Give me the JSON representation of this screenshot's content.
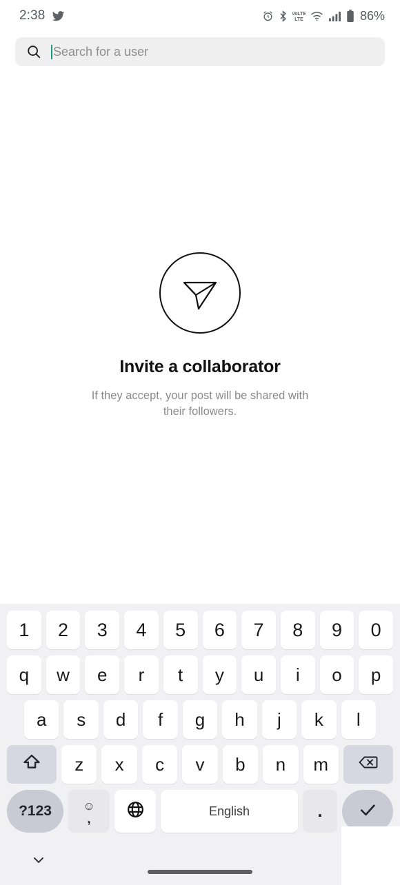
{
  "statusbar": {
    "time": "2:38",
    "app_icon": "twitter-icon",
    "icons": [
      "alarm-icon",
      "bluetooth-icon",
      "volte-icon",
      "wifi-icon",
      "cellular-signal-icon",
      "battery-icon"
    ],
    "battery_percent": "86%"
  },
  "search": {
    "icon": "search-icon",
    "placeholder": "Search for a user",
    "value": "",
    "caret_color": "#1a9c7e"
  },
  "empty_state": {
    "icon": "send-paper-plane-icon",
    "title": "Invite a collaborator",
    "subtitle": "If they accept, your post will be shared with their followers."
  },
  "keyboard": {
    "rows": {
      "numbers": [
        "1",
        "2",
        "3",
        "4",
        "5",
        "6",
        "7",
        "8",
        "9",
        "0"
      ],
      "top": [
        "q",
        "w",
        "e",
        "r",
        "t",
        "y",
        "u",
        "i",
        "o",
        "p"
      ],
      "home": [
        "a",
        "s",
        "d",
        "f",
        "g",
        "h",
        "j",
        "k",
        "l"
      ],
      "bottom_letters": [
        "z",
        "x",
        "c",
        "v",
        "b",
        "n",
        "m"
      ]
    },
    "shift_key": "shift-icon",
    "backspace_key": "backspace-icon",
    "symbols_key": "?123",
    "emoji_key": "emoji-icon",
    "comma_key": ",",
    "language_key": "globe-icon",
    "space_key": "English",
    "period_key": ".",
    "enter_key": "check-icon"
  },
  "navbar": {
    "hide_keyboard": "chevron-down-icon",
    "home_pill": "home-gesture-pill"
  }
}
